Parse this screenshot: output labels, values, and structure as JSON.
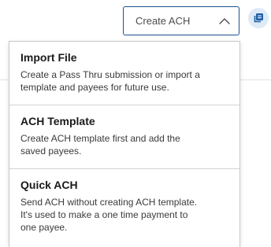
{
  "trigger": {
    "label": "Create ACH",
    "icon": "chevron-up-icon",
    "border_color": "#1c4f8f"
  },
  "side_button": {
    "icon": "copy-icon",
    "background": "#dfeaf7",
    "icon_color": "#1c5fa8"
  },
  "menu": {
    "items": [
      {
        "title": "Import File",
        "lines": [
          "Create a Pass Thru submission or import a",
          "template and payees for future use."
        ]
      },
      {
        "title": "ACH Template",
        "lines": [
          "Create ACH template first and add the",
          "saved payees."
        ]
      },
      {
        "title": "Quick ACH",
        "lines": [
          "Send ACH without creating ACH template.",
          "It's used to make a one time payment to",
          "one payee."
        ]
      }
    ]
  }
}
